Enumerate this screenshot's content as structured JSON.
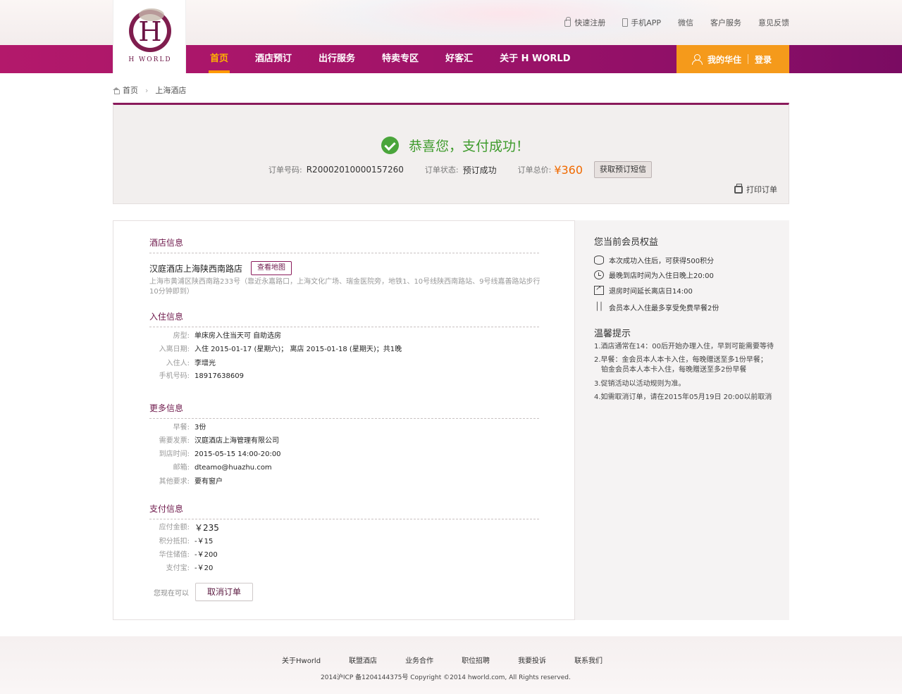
{
  "header": {
    "logo_text": "H WORLD",
    "top_links": [
      "快速注册",
      "手机APP",
      "微信",
      "客户服务",
      "意见反馈"
    ],
    "nav": [
      "首页",
      "酒店预订",
      "出行服务",
      "特卖专区",
      "好客汇",
      "关于 H WORLD"
    ],
    "member_label": "我的华住",
    "login_label": "登录"
  },
  "breadcrumb": {
    "home": "首页",
    "current": "上海酒店"
  },
  "success": {
    "title": "恭喜您，支付成功！",
    "order_no_label": "订单号码:",
    "order_no": "R20002010000157260",
    "status_label": "订单状态:",
    "status": "预订成功",
    "total_label": "订单总价:",
    "total": "¥360",
    "sms_button": "获取预订短信",
    "print": "打印订单"
  },
  "hotel": {
    "section_title": "酒店信息",
    "name": "汉庭酒店上海陕西南路店",
    "map_button": "查看地图",
    "address": "上海市黄浦区陕西南路233号（靠近永嘉路口，上海文化广场、瑞金医院旁，地铁1、10号线陕西南路站、9号线嘉善路站步行10分钟即到）"
  },
  "checkin": {
    "section_title": "入住信息",
    "items": [
      {
        "k": "房型:",
        "v": "单床房入住当天可  自助选房"
      },
      {
        "k": "入离日期:",
        "v": "入住 2015-01-17 (星期六)；  离店 2015-01-18 (星期天)；共1晚"
      },
      {
        "k": "入住人:",
        "v": "李增光"
      },
      {
        "k": "手机号码:",
        "v": "18917638609"
      }
    ]
  },
  "more": {
    "section_title": "更多信息",
    "items": [
      {
        "k": "早餐:",
        "v": "3份"
      },
      {
        "k": "需要发票:",
        "v": "汉庭酒店上海管理有限公司"
      },
      {
        "k": "到店时间:",
        "v": "2015-05-15 14:00-20:00"
      },
      {
        "k": "邮箱:",
        "v": "dteamo@huazhu.com"
      },
      {
        "k": "其他要求:",
        "v": "要有窗户"
      }
    ]
  },
  "payment": {
    "section_title": "支付信息",
    "items": [
      {
        "k": "应付金额:",
        "v": "￥235"
      },
      {
        "k": "积分抵扣:",
        "v": "-￥15"
      },
      {
        "k": "华住储值:",
        "v": "-￥200"
      },
      {
        "k": "支付宝:",
        "v": "-￥20"
      }
    ],
    "cancel_prompt": "您现在可以",
    "cancel_button": "取消订单"
  },
  "benefits": {
    "title": "您当前会员权益",
    "items": [
      {
        "icon": "coins-icon",
        "text": "本次成功入住后，可获得500积分"
      },
      {
        "icon": "clock-icon",
        "text": "最晚到店时间为入住日晚上20:00"
      },
      {
        "icon": "checkout-icon",
        "text": "退房时间延长离店日14:00"
      },
      {
        "icon": "fork-knife-icon",
        "text": "会员本人入住最多享受免费早餐2份"
      }
    ]
  },
  "tips": {
    "title": "温馨提示",
    "items": [
      "1.酒店通常在14：00后开始办理入住，早到可能需要等待",
      "2.早餐：金会员本人本卡入住，每晚赠送至多1份早餐；",
      "铂金会员本人本卡入住，每晚赠送至多2份早餐",
      "3.促销活动以活动规则为准。",
      "4.如需取消订单，请在2015年05月19日 20:00以前取消"
    ]
  },
  "footer": {
    "links": [
      "关于Hworld",
      "联盟酒店",
      "业务合作",
      "职位招聘",
      "我要投诉",
      "联系我们"
    ],
    "copyright": "2014沪ICP 备1204144375号 Copyright ©2014 hworld.com, All Rights reserved."
  },
  "colors": {
    "brand": "#8a1a5b",
    "accent": "#f59a1b",
    "success": "#3e9b2c",
    "price": "#f06a00"
  }
}
